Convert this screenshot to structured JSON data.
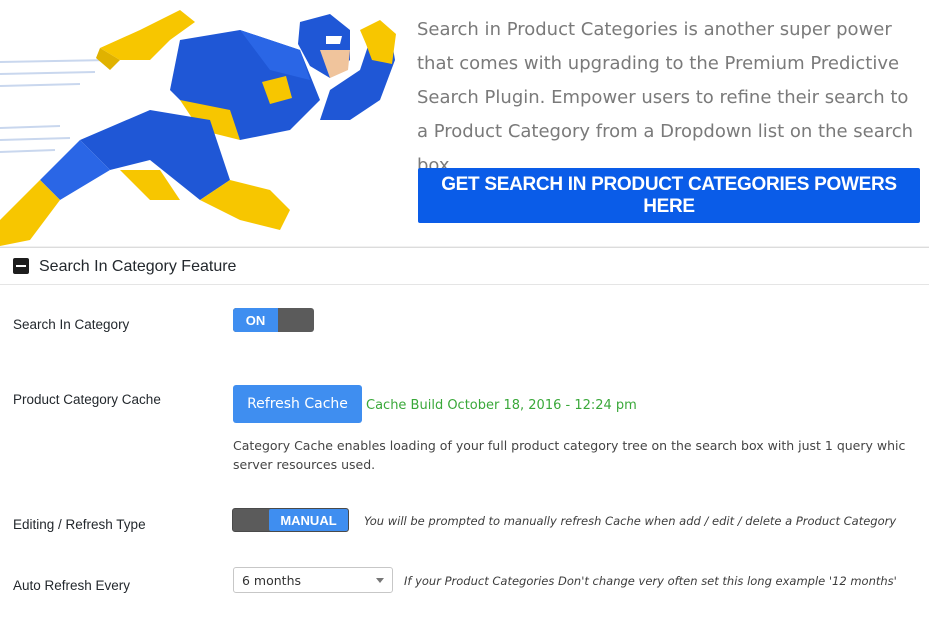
{
  "banner": {
    "promo_text": "Search in Product Categories is another super power that comes with upgrading to the Premium Predictive Search Plugin. Empower users to refine their search to a Product Category from a Dropdown list on the search box.",
    "cta_label": "GET SEARCH IN PRODUCT CATEGORIES POWERS HERE",
    "hero_icon": "superhero-illustration"
  },
  "panel": {
    "title": "Search In Category Feature",
    "rows": {
      "search_in_category": {
        "label": "Search In Category",
        "toggle": "ON"
      },
      "category_cache": {
        "label": "Product Category Cache",
        "button": "Refresh Cache",
        "status": "Cache Build October 18, 2016 - 12:24 pm",
        "help_line1": "Category Cache enables loading of your full product category tree on the search box with just 1 query whic",
        "help_line2": "server resources used."
      },
      "refresh_type": {
        "label": "Editing / Refresh Type",
        "toggle": "MANUAL",
        "hint": "You will be prompted to manually refresh Cache when add / edit / delete a Product Category"
      },
      "auto_refresh": {
        "label": "Auto Refresh Every",
        "selected": "6 months",
        "hint": "If your Product Categories Don't change very often set this long example '12 months'"
      }
    }
  },
  "colors": {
    "accent": "#0a5ce8",
    "toggle_blue": "#3f8ef0",
    "status_green": "#3aa83a",
    "hero_blue": "#1f57d6",
    "hero_yellow": "#f7c600"
  }
}
